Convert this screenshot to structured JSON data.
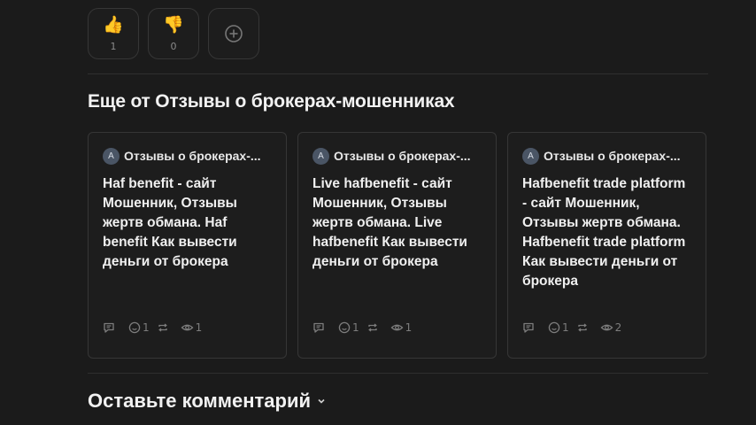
{
  "reactions": [
    {
      "emoji": "👍",
      "count": "1"
    },
    {
      "emoji": "👎",
      "count": "0"
    }
  ],
  "section_title": "Еще от Отзывы о брокерах-мошенниках",
  "cards": [
    {
      "avatar": "A",
      "source": "Отзывы о брокерах-...",
      "title": "Haf benefit - сайт Мошенник, Отзывы жертв обмана. Haf benefit Как вывести деньги от брокера",
      "likes": "1",
      "views": "1"
    },
    {
      "avatar": "A",
      "source": "Отзывы о брокерах-...",
      "title": "Live hafbenefit - сайт Мошенник, Отзывы жертв обмана. Live hafbenefit Как вывести деньги от брокера",
      "likes": "1",
      "views": "1"
    },
    {
      "avatar": "A",
      "source": "Отзывы о брокерах-...",
      "title": "Hafbenefit trade platform - сайт Мошенник, Отзывы жертв обмана. Hafbenefit trade platform Как вывести деньги от брокера",
      "likes": "1",
      "views": "2"
    }
  ],
  "comment_title": "Оставьте комментарий",
  "icons": {
    "comment": "comment-icon",
    "like": "smile-icon",
    "repost": "repost-icon",
    "view": "eye-icon",
    "add_reaction": "plus-circle-icon",
    "expand": "chevron-down-icon"
  }
}
